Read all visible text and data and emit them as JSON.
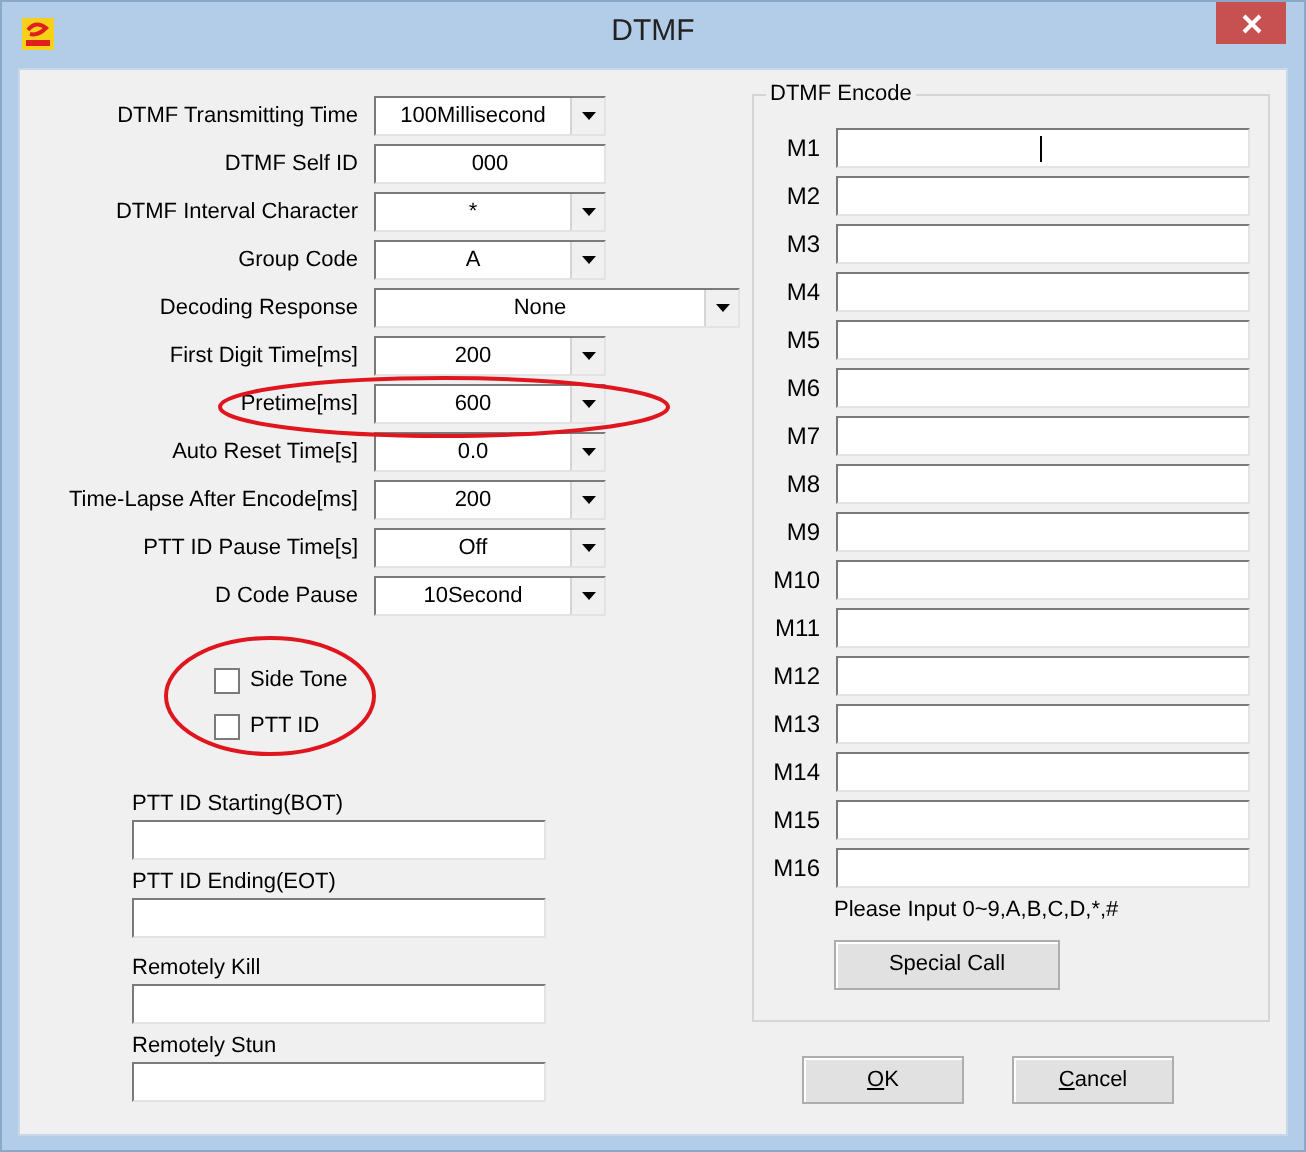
{
  "window": {
    "title": "DTMF"
  },
  "settings": [
    {
      "label": "DTMF Transmitting Time",
      "kind": "combo",
      "value": "100Millisecond",
      "wide": false,
      "highlighted": false
    },
    {
      "label": "DTMF Self ID",
      "kind": "text",
      "value": "000",
      "wide": false,
      "highlighted": false
    },
    {
      "label": "DTMF Interval Character",
      "kind": "combo",
      "value": "*",
      "wide": false,
      "highlighted": false
    },
    {
      "label": "Group Code",
      "kind": "combo",
      "value": "A",
      "wide": false,
      "highlighted": false
    },
    {
      "label": "Decoding Response",
      "kind": "combo",
      "value": "None",
      "wide": true,
      "highlighted": false
    },
    {
      "label": "First Digit Time[ms]",
      "kind": "combo",
      "value": "200",
      "wide": false,
      "highlighted": false
    },
    {
      "label": "Pretime[ms]",
      "kind": "combo",
      "value": "600",
      "wide": false,
      "highlighted": true
    },
    {
      "label": "Auto Reset Time[s]",
      "kind": "combo",
      "value": "0.0",
      "wide": false,
      "highlighted": false
    },
    {
      "label": "Time-Lapse After Encode[ms]",
      "kind": "combo",
      "value": "200",
      "wide": false,
      "highlighted": false
    },
    {
      "label": "PTT ID Pause Time[s]",
      "kind": "combo",
      "value": "Off",
      "wide": false,
      "highlighted": false
    },
    {
      "label": "D Code Pause",
      "kind": "combo",
      "value": "10Second",
      "wide": false,
      "highlighted": false
    }
  ],
  "checkboxes_highlighted": true,
  "checkboxes": [
    {
      "label": "Side Tone",
      "checked": false
    },
    {
      "label": "PTT ID",
      "checked": false
    }
  ],
  "id_fields": [
    {
      "label": "PTT ID Starting(BOT)"
    },
    {
      "label": "PTT ID Ending(EOT)"
    },
    {
      "label": "Remotely Kill"
    },
    {
      "label": "Remotely Stun"
    }
  ],
  "encode": {
    "title": "DTMF Encode",
    "slots": [
      {
        "label": "M1",
        "focused": true
      },
      {
        "label": "M2",
        "focused": false
      },
      {
        "label": "M3",
        "focused": false
      },
      {
        "label": "M4",
        "focused": false
      },
      {
        "label": "M5",
        "focused": false
      },
      {
        "label": "M6",
        "focused": false
      },
      {
        "label": "M7",
        "focused": false
      },
      {
        "label": "M8",
        "focused": false
      },
      {
        "label": "M9",
        "focused": false
      },
      {
        "label": "M10",
        "focused": false
      },
      {
        "label": "M11",
        "focused": false
      },
      {
        "label": "M12",
        "focused": false
      },
      {
        "label": "M13",
        "focused": false
      },
      {
        "label": "M14",
        "focused": false
      },
      {
        "label": "M15",
        "focused": false
      },
      {
        "label": "M16",
        "focused": false
      }
    ],
    "hint": "Please Input 0~9,A,B,C,D,*,#",
    "special_call": "Special Call"
  },
  "buttons": [
    {
      "label": "OK"
    },
    {
      "label": "Cancel"
    }
  ]
}
